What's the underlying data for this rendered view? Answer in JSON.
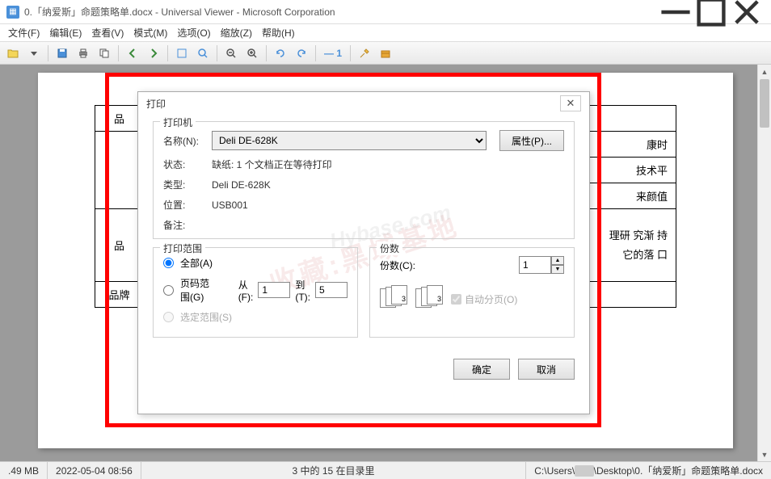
{
  "window": {
    "title": "0.「纳爱斯」命题策略单.docx - Universal Viewer - Microsoft Corporation"
  },
  "menu": {
    "file": "文件(F)",
    "edit": "编辑(E)",
    "view": "查看(V)",
    "mode": "模式(M)",
    "options": "选项(O)",
    "zoom": "缩放(Z)",
    "help": "帮助(H)"
  },
  "doc_table": {
    "row1_label": "品",
    "row2_right": "康时",
    "row3_right": "技术平",
    "row4_right": "来颜值",
    "row5_label": "品",
    "row5_right_a": "理研 究渐 持",
    "row5_right_b": "它的落 口",
    "row6_label": "品牌"
  },
  "print_dialog": {
    "title": "打印",
    "group_printer": "打印机",
    "label_name": "名称(N):",
    "printer_name": "Deli DE-628K",
    "btn_properties": "属性(P)...",
    "label_status": "状态:",
    "status_value": "缺纸:  1 个文档正在等待打印",
    "label_type": "类型:",
    "type_value": "Deli DE-628K",
    "label_location": "位置:",
    "location_value": "USB001",
    "label_comment": "备注:",
    "comment_value": "",
    "group_range": "打印范围",
    "radio_all": "全部(A)",
    "radio_pages": "页码范围(G)",
    "label_from": "从(F):",
    "from_value": "1",
    "label_to": "到(T):",
    "to_value": "5",
    "radio_selection": "选定范围(S)",
    "group_copies": "份数",
    "label_copies": "份数(C):",
    "copies_value": "1",
    "label_collate": "自动分页(O)",
    "btn_ok": "确定",
    "btn_cancel": "取消"
  },
  "watermark": {
    "text1": "收藏:黑域基地",
    "text2": "Hybase.com"
  },
  "statusbar": {
    "size": ".49 MB",
    "datetime": "2022-05-04 08:56",
    "pageinfo": "3 中的 15 在目录里",
    "path_prefix": "C:\\Users\\",
    "path_suffix": "\\Desktop\\0.「纳爱斯」命题策略单.docx"
  }
}
